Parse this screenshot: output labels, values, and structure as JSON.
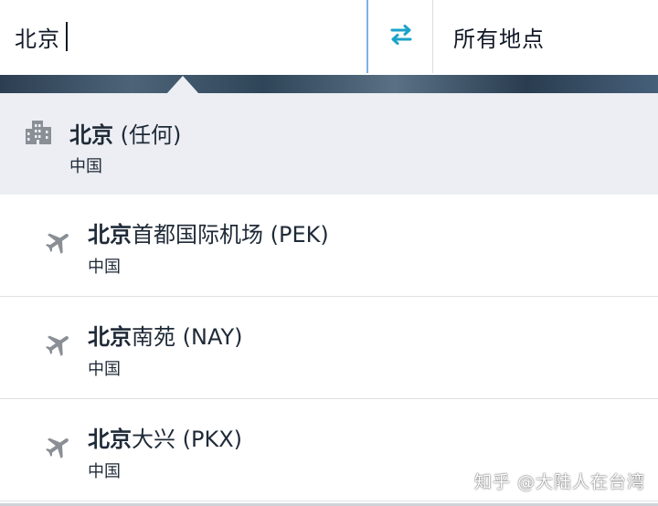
{
  "search": {
    "origin_value": "北京",
    "destination_value": "所有地点"
  },
  "colors": {
    "swap_icon": "#1aa3c9",
    "plane_icon": "#8a8f96",
    "city_icon": "#8a8f96",
    "highlight_row": "#eceef3",
    "origin_focus_border": "#7fb0e6"
  },
  "suggestions": [
    {
      "type": "city",
      "icon": "city-icon",
      "name_bold": "北京",
      "name_rest": " (任何)",
      "country": "中国"
    },
    {
      "type": "airport",
      "icon": "plane-icon",
      "name_bold": "北京",
      "name_rest": "首都国际机场 (PEK)",
      "country": "中国"
    },
    {
      "type": "airport",
      "icon": "plane-icon",
      "name_bold": "北京",
      "name_rest": "南苑 (NAY)",
      "country": "中国"
    },
    {
      "type": "airport",
      "icon": "plane-icon",
      "name_bold": "北京",
      "name_rest": "大兴 (PKX)",
      "country": "中国"
    }
  ],
  "watermark": "知乎 @大陆人在台湾"
}
